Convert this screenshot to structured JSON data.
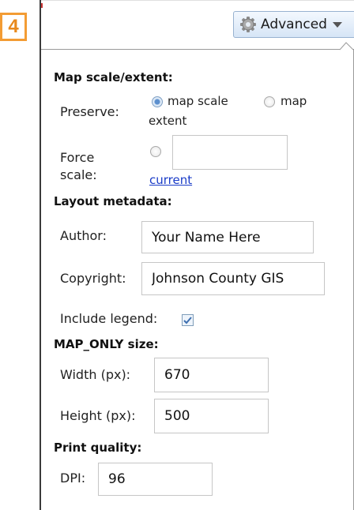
{
  "step": {
    "number": "4"
  },
  "toolbar": {
    "advanced_label": "Advanced"
  },
  "map_scale": {
    "heading": "Map scale/extent:",
    "preserve_label": "Preserve:",
    "option_scale": "map scale",
    "option_extent_line1": "map",
    "option_extent_line2": "extent",
    "selected": "map scale",
    "force_label_line1": "Force",
    "force_label_line2": "scale:",
    "force_value": "",
    "current_link": "current"
  },
  "layout_metadata": {
    "heading": "Layout metadata:",
    "author_label": "Author:",
    "author_value": "Your Name Here",
    "copyright_label": "Copyright:",
    "copyright_value": "Johnson County GIS",
    "legend_label": "Include legend:",
    "legend_checked": true
  },
  "map_only_size": {
    "heading": "MAP_ONLY size:",
    "width_label": "Width (px):",
    "width_value": "670",
    "height_label": "Height (px):",
    "height_value": "500"
  },
  "print_quality": {
    "heading": "Print quality:",
    "dpi_label": "DPI:",
    "dpi_value": "96"
  },
  "colors": {
    "step_badge": "#f39c34",
    "link": "#1a3cc8",
    "radio_selected": "#5c8fce"
  },
  "icons": {
    "advanced": "gear-icon",
    "dropdown": "chevron-down-icon",
    "legend_check": "checkmark-icon"
  }
}
